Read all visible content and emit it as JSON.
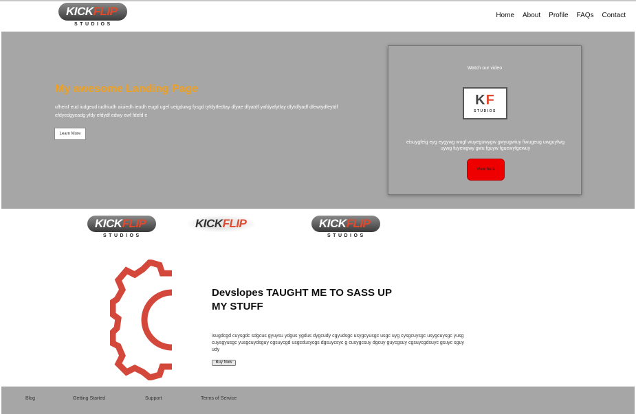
{
  "header": {
    "logo": {
      "word_left": "KICK",
      "word_right": "FLIP",
      "subtitle": "STUDIOS"
    },
    "nav": [
      "Home",
      "About",
      "Profile",
      "FAQs",
      "Contact"
    ]
  },
  "hero": {
    "title": "My awesome Landing Page",
    "text": "ufheisf eud iudgeud iudhiudh aiuiedh ieudh eugd ugef ueigduwg fysgd tyfdytfedtay dfyae dfyatdf yafdyafytfay dfytdfyadf dfewtydfeytdf efdyedgyeadg yfdy efdydf edwy ewf fdefd e",
    "button_label": "Learn More",
    "video_card": {
      "title": "Watch our video",
      "kf_logo": {
        "k": "K",
        "f": "F",
        "subtitle": "STUDIOS"
      },
      "text": "eisuygfeig eyg eygywg wugf wuyeguwygw gwyugwiuy fiwugeug uwguyfwg uywg fuyewgwy gwu fguyw fguewyfgewuy",
      "button_label": "View here"
    }
  },
  "logo_strip": [
    {
      "word_left": "KICK",
      "word_right": "FLIP",
      "subtitle": "STUDIOS"
    },
    {
      "word_left": "KICK",
      "word_right": "FLIP"
    },
    {
      "word_left": "KICK",
      "word_right": "FLIP",
      "subtitle": "STUDIOS"
    }
  ],
  "feature": {
    "title": "Devslopes TAUGHT ME TO SASS UP MY STUFF",
    "text": "isugdcgd cuysgdc sdgcus gyuysu ydgus ygdus dygcudy cgyudsgc usygcyusgc usgc uyg cysgcuysgc usygcuysgc yusg cuysgyusgc yusgcuydsguy cgsuycgd usgcdusycgs dgsuycsyc g cusygcsuy dgcuy guycgsuy cgsuycgdsuyc gsuyc sguy udy",
    "button_label": "Buy Now"
  },
  "footer": {
    "links": [
      "Blog",
      "Getting Started",
      "Support",
      "Terms of Service"
    ]
  },
  "colors": {
    "hero_bg": "#a6a6a6",
    "accent_orange": "#f0a020",
    "brand_red": "#e04a2e",
    "view_button": "#ee0000"
  },
  "icons": {
    "feature_graphic": "gear-icon"
  }
}
